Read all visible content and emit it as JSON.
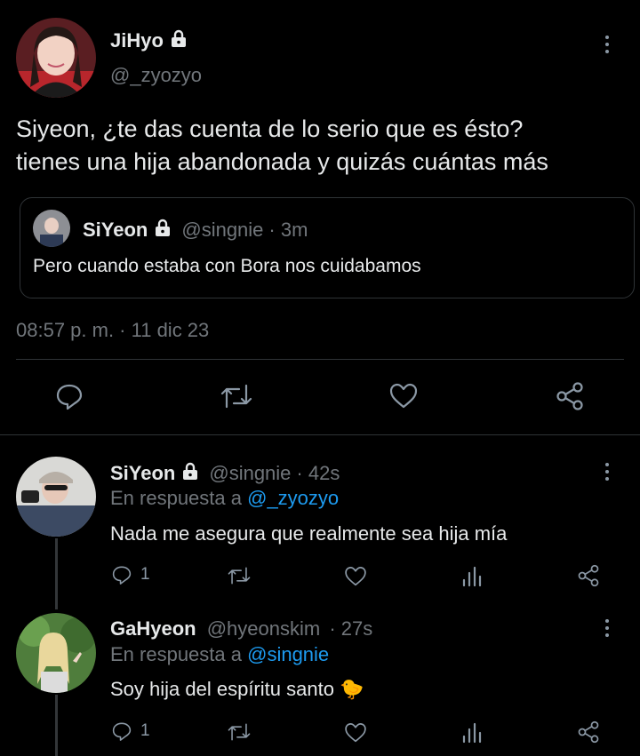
{
  "main_tweet": {
    "author_name": "JiHyo",
    "handle": "@_zyozyo",
    "text_line1": "Siyeon, ¿te das cuenta de lo serio que es ésto?",
    "text_line2": "tienes una hija abandonada y quizás cuántas más",
    "quoted": {
      "author_name": "SiYeon",
      "handle": "@singnie",
      "time": "· 3m",
      "text": "Pero cuando estaba con Bora nos cuidabamos"
    },
    "timestamp": "08:57 p. m. · 11 dic 23"
  },
  "replies": [
    {
      "author_name": "SiYeon",
      "handle": "@singnie",
      "time": "· 42s",
      "reply_prefix": "En respuesta a",
      "reply_to": "@_zyozyo",
      "text": "Nada me asegura que realmente sea hija mía",
      "reply_count": "1"
    },
    {
      "author_name": "GaHyeon",
      "handle": "@hyeonskim",
      "time": "· 27s",
      "reply_prefix": "En respuesta a",
      "reply_to": "@singnie",
      "text": "Soy hija del espíritu santo",
      "emoji": "🐤",
      "reply_count": "1"
    }
  ],
  "icons": {
    "lock": "lock-icon",
    "more": "more-options-icon",
    "reply": "reply-icon",
    "retweet": "retweet-icon",
    "like": "like-icon",
    "share": "share-icon",
    "views": "views-icon"
  },
  "colors": {
    "background": "#000000",
    "text": "#e7e9ea",
    "muted": "#71767b",
    "link": "#1d9bf0"
  }
}
